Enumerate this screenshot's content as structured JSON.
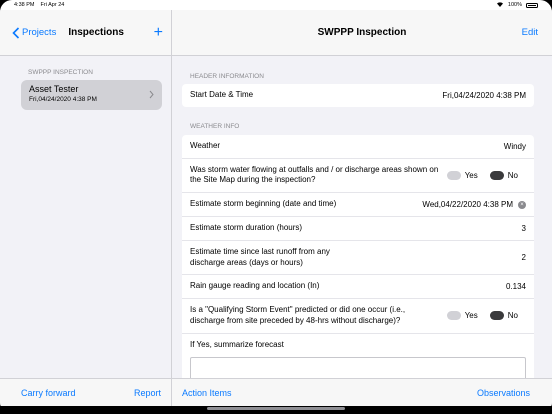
{
  "status_bar": {
    "time": "4:38 PM",
    "date": "Fri Apr 24",
    "battery": "100%"
  },
  "sidebar": {
    "back_label": "Projects",
    "title": "Inspections",
    "add_label": "+",
    "section": "SWPPP INSPECTION",
    "item": {
      "title": "Asset Tester",
      "subtitle": "Fri,04/24/2020 4:38 PM"
    },
    "bottom_left": "Carry forward",
    "bottom_right": "Report"
  },
  "main": {
    "title": "SWPPP Inspection",
    "edit_label": "Edit",
    "header_section": "HEADER INFORMATION",
    "start_label": "Start Date & Time",
    "start_value": "Fri,04/24/2020 4:38 PM",
    "weather_section": "WEATHER INFO",
    "weather_label": "Weather",
    "weather_value": "Windy",
    "q_flowing": "Was storm water flowing at outfalls and / or discharge areas shown on the Site Map during the inspection?",
    "yes_label": "Yes",
    "no_label": "No",
    "storm_begin_label": "Estimate storm beginning (date and time)",
    "storm_begin_value": "Wed,04/22/2020 4:38 PM",
    "duration_label": "Estimate storm duration (hours)",
    "duration_value": "3",
    "since_runoff_label": "Estimate time since last runoff from any discharge areas (days or hours)",
    "since_runoff_value": "2",
    "rain_label": "Rain gauge reading and location (In)",
    "rain_value": "0.134",
    "q_qualifying": "Is a \"Qualifying Storm Event\" predicted or did one occur (i.e., discharge from site preceded by 48-hrs without discharge)?",
    "forecast_label": "If Yes, summarize forecast",
    "forecast_value": "",
    "bottom_left": "Action Items",
    "bottom_right": "Observations"
  },
  "colors": {
    "accent": "#0a7aff",
    "selected_radio": "#3a3a3c",
    "unselected_radio": "#d1d1d6"
  }
}
